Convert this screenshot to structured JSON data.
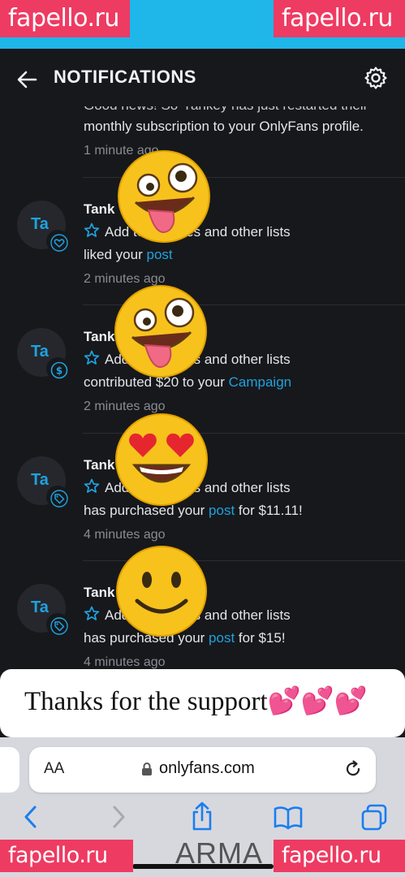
{
  "status": {
    "time": "...:..."
  },
  "watermark": {
    "text": "fapello.ru"
  },
  "header": {
    "title": "NOTIFICATIONS"
  },
  "notifications": [
    {
      "partial_line1": "Good news! So-Yankey has just restarted their",
      "line2": "monthly subscription to your OnlyFans profile.",
      "time": "1 minute ago"
    },
    {
      "initials": "Ta",
      "badge": "heart-icon",
      "name": "Tank",
      "line1": "Add to favorites and other lists",
      "line2_prefix": "liked your ",
      "line2_link": "post",
      "line2_suffix": "",
      "time": "2 minutes ago"
    },
    {
      "initials": "Ta",
      "badge": "dollar-icon",
      "name": "Tank",
      "line1": "Add to favorites and other lists",
      "line2_prefix": "contributed $20 to your ",
      "line2_link": "Campaign",
      "line2_suffix": "",
      "time": "2 minutes ago"
    },
    {
      "initials": "Ta",
      "badge": "tag-icon",
      "name": "Tank",
      "line1": "Add to favorites and other lists",
      "line2_prefix": "has purchased your ",
      "line2_link": "post",
      "line2_suffix": " for $11.11!",
      "time": "4 minutes ago"
    },
    {
      "initials": "Ta",
      "badge": "tag-icon",
      "name": "Tank",
      "line1": "Add to favorites and other lists",
      "line2_prefix": "has purchased your ",
      "line2_link": "post",
      "line2_suffix": " for $15!",
      "time": "4 minutes ago"
    }
  ],
  "caption": {
    "text": "Thanks for the support💕💕💕"
  },
  "browser": {
    "aa_label": "AA",
    "url": "onlyfans.com"
  },
  "bottom_text": "ARMA",
  "colors": {
    "accent": "#1fa2e0",
    "background": "#17181b",
    "watermark": "#ee3b62",
    "status_strip": "#1fb6ea"
  }
}
